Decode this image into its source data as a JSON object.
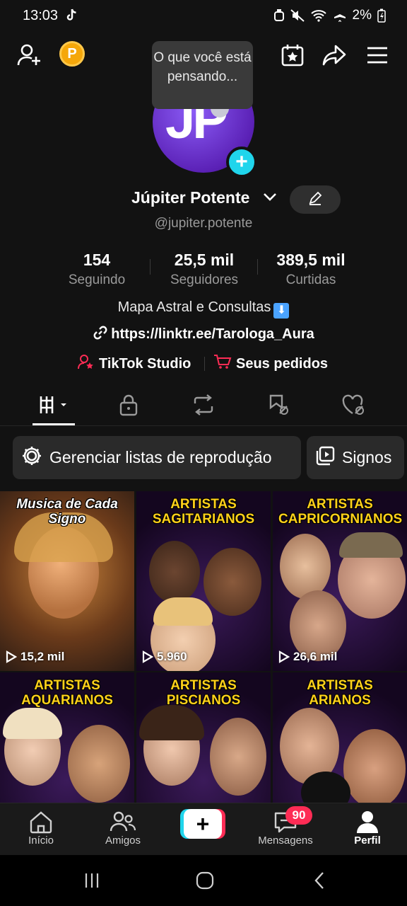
{
  "status_bar": {
    "time": "13:03",
    "battery": "2%"
  },
  "header": {
    "coin_letter": "P"
  },
  "tooltip": {
    "text": "O que você está pensando..."
  },
  "profile": {
    "avatar_initials": "JP",
    "display_name": "Júpiter Potente",
    "handle": "@jupiter.potente"
  },
  "stats": [
    {
      "value": "154",
      "label": "Seguindo"
    },
    {
      "value": "25,5 mil",
      "label": "Seguidores"
    },
    {
      "value": "389,5 mil",
      "label": "Curtidas"
    }
  ],
  "bio": {
    "text": "Mapa Astral e Consultas",
    "emoji": "⬇",
    "link": "https://linktr.ee/Tarologa_Aura"
  },
  "tools": {
    "studio": "TikTok Studio",
    "orders": "Seus pedidos"
  },
  "playlist_buttons": {
    "manage": "Gerenciar listas de reprodução",
    "signos": "Signos"
  },
  "videos": [
    {
      "title": "Musica de Cada Signo",
      "views": "15,2 mil"
    },
    {
      "title": "ARTISTAS SAGITARIANOS",
      "views": "5.960"
    },
    {
      "title": "ARTISTAS CAPRICORNIANOS",
      "views": "26,6 mil"
    },
    {
      "title": "ARTISTAS AQUARIANOS",
      "views": ""
    },
    {
      "title": "ARTISTAS PISCIANOS",
      "views": ""
    },
    {
      "title": "ARTISTAS ARIANOS",
      "views": ""
    }
  ],
  "bottom_nav": {
    "home": "Início",
    "friends": "Amigos",
    "messages": "Mensagens",
    "messages_badge": "90",
    "profile": "Perfil"
  },
  "colors": {
    "accent_cyan": "#20d5ec",
    "accent_red": "#fe2c55",
    "title_yellow": "#ffd11a"
  }
}
